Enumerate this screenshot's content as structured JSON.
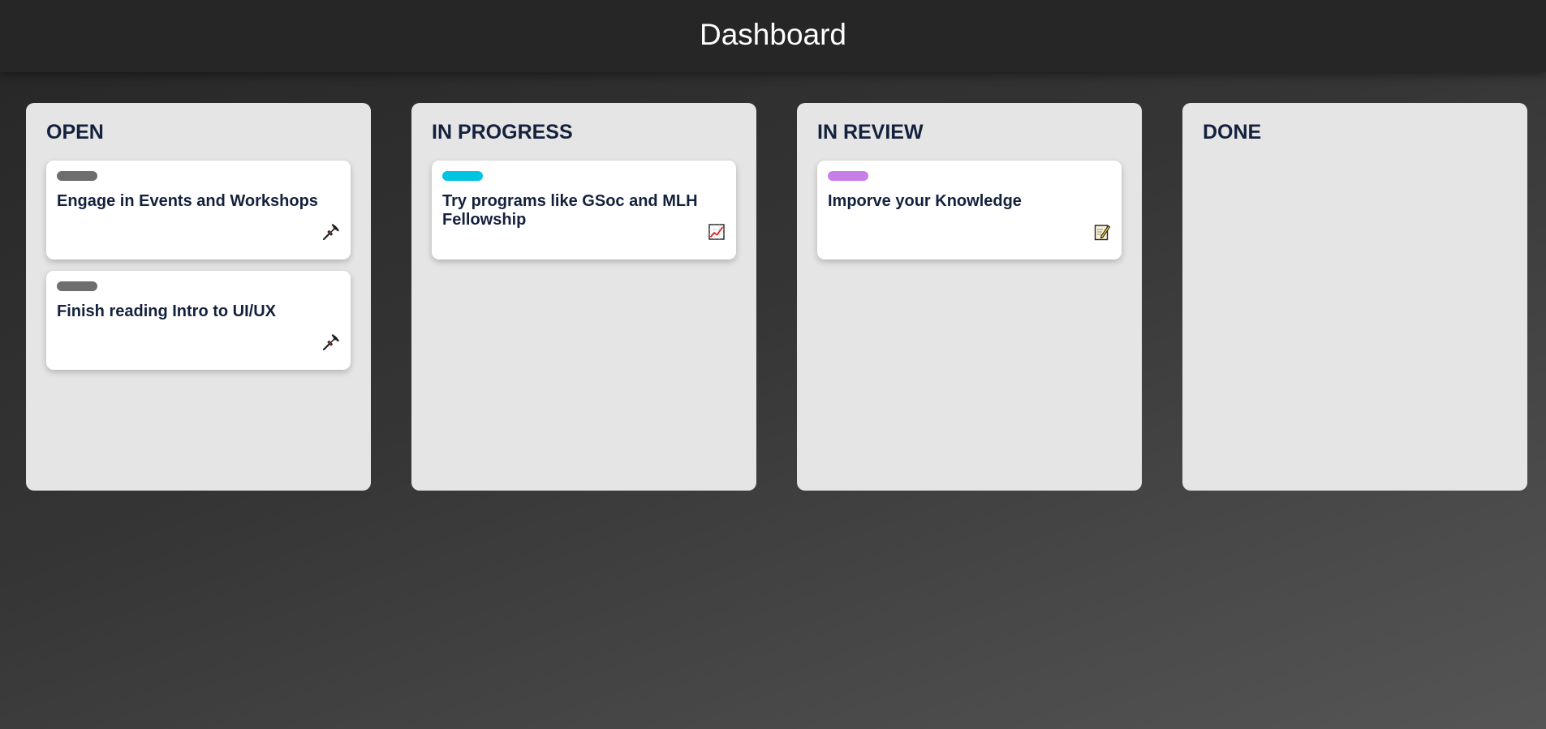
{
  "header": {
    "title": "Dashboard"
  },
  "columns": [
    {
      "title": "OPEN",
      "cards": [
        {
          "title": "Engage in Events and Workshops",
          "tag_color": "#6e6e6e",
          "icon": "pushpin-icon"
        },
        {
          "title": "Finish reading Intro to UI/UX",
          "tag_color": "#6e6e6e",
          "icon": "pushpin-icon"
        }
      ]
    },
    {
      "title": "IN PROGRESS",
      "cards": [
        {
          "title": "Try programs like GSoc and MLH Fellowship",
          "tag_color": "#00c4e0",
          "icon": "chart-increasing-icon"
        }
      ]
    },
    {
      "title": "IN REVIEW",
      "cards": [
        {
          "title": "Imporve your Knowledge",
          "tag_color": "#c77ee6",
          "icon": "memo-icon"
        }
      ]
    },
    {
      "title": "DONE",
      "cards": []
    }
  ]
}
